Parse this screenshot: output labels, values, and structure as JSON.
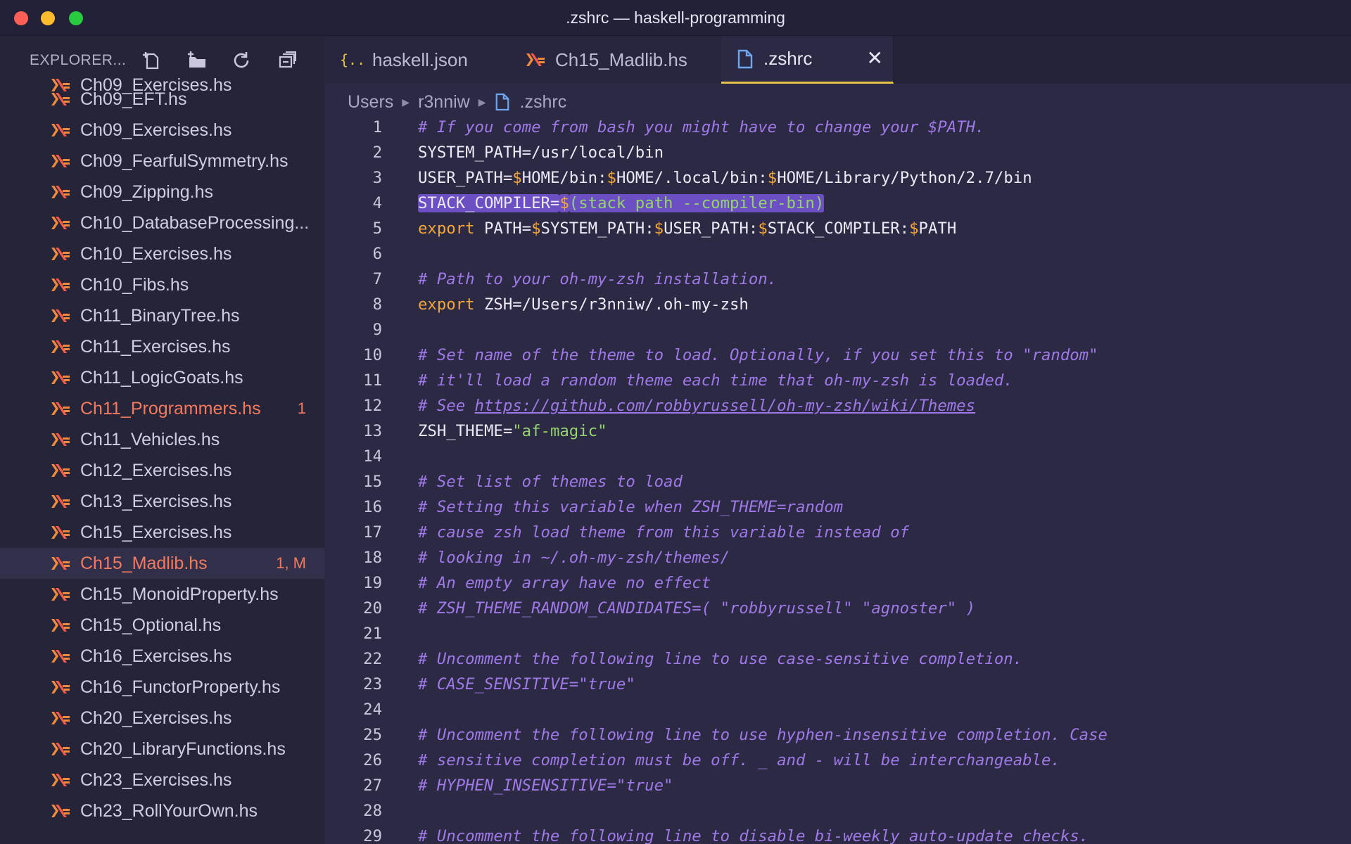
{
  "window": {
    "title": ".zshrc — haskell-programming"
  },
  "sidebar": {
    "title": "EXPLORER...",
    "partial_item": "Ch09_Exercises.hs",
    "items": [
      {
        "label": "Ch09_EFT.hs",
        "badge": "",
        "state": "normal"
      },
      {
        "label": "Ch09_Exercises.hs",
        "badge": "",
        "state": "normal"
      },
      {
        "label": "Ch09_FearfulSymmetry.hs",
        "badge": "",
        "state": "normal"
      },
      {
        "label": "Ch09_Zipping.hs",
        "badge": "",
        "state": "normal"
      },
      {
        "label": "Ch10_DatabaseProcessing...",
        "badge": "",
        "state": "normal"
      },
      {
        "label": "Ch10_Exercises.hs",
        "badge": "",
        "state": "normal"
      },
      {
        "label": "Ch10_Fibs.hs",
        "badge": "",
        "state": "normal"
      },
      {
        "label": "Ch11_BinaryTree.hs",
        "badge": "",
        "state": "normal"
      },
      {
        "label": "Ch11_Exercises.hs",
        "badge": "",
        "state": "normal"
      },
      {
        "label": "Ch11_LogicGoats.hs",
        "badge": "",
        "state": "normal"
      },
      {
        "label": "Ch11_Programmers.hs",
        "badge": "1",
        "state": "error"
      },
      {
        "label": "Ch11_Vehicles.hs",
        "badge": "",
        "state": "normal"
      },
      {
        "label": "Ch12_Exercises.hs",
        "badge": "",
        "state": "normal"
      },
      {
        "label": "Ch13_Exercises.hs",
        "badge": "",
        "state": "normal"
      },
      {
        "label": "Ch15_Exercises.hs",
        "badge": "",
        "state": "normal"
      },
      {
        "label": "Ch15_Madlib.hs",
        "badge": "1, M",
        "state": "error-selected"
      },
      {
        "label": "Ch15_MonoidProperty.hs",
        "badge": "",
        "state": "normal"
      },
      {
        "label": "Ch15_Optional.hs",
        "badge": "",
        "state": "normal"
      },
      {
        "label": "Ch16_Exercises.hs",
        "badge": "",
        "state": "normal"
      },
      {
        "label": "Ch16_FunctorProperty.hs",
        "badge": "",
        "state": "normal"
      },
      {
        "label": "Ch20_Exercises.hs",
        "badge": "",
        "state": "normal"
      },
      {
        "label": "Ch20_LibraryFunctions.hs",
        "badge": "",
        "state": "normal"
      },
      {
        "label": "Ch23_Exercises.hs",
        "badge": "",
        "state": "normal"
      },
      {
        "label": "Ch23_RollYourOwn.hs",
        "badge": "",
        "state": "normal"
      }
    ]
  },
  "tabs": [
    {
      "label": "haskell.json",
      "icon": "json-braces-icon",
      "active": false
    },
    {
      "label": "Ch15_Madlib.hs",
      "icon": "haskell-icon",
      "active": false
    },
    {
      "label": ".zshrc",
      "icon": "file-icon",
      "active": true
    }
  ],
  "breadcrumb": [
    "Users",
    "r3nniw",
    ".zshrc"
  ],
  "code": {
    "lines": [
      [
        [
          "comment",
          "# If you come from bash you might have to change your $PATH."
        ]
      ],
      [
        [
          "plain",
          "SYSTEM_PATH=/usr/local/bin"
        ]
      ],
      [
        [
          "plain",
          "USER_PATH="
        ],
        [
          "dollar",
          "$"
        ],
        [
          "plain",
          "HOME/bin:"
        ],
        [
          "dollar",
          "$"
        ],
        [
          "plain",
          "HOME/.local/bin:"
        ],
        [
          "dollar",
          "$"
        ],
        [
          "plain",
          "HOME/Library/Python/2.7/bin"
        ]
      ],
      [
        [
          "hl-plain",
          "STACK_COMPILER="
        ],
        [
          "hl-dollar",
          "$"
        ],
        [
          "hl-string",
          "(stack path --compiler-bin)"
        ]
      ],
      [
        [
          "keyword",
          "export"
        ],
        [
          "plain",
          " PATH="
        ],
        [
          "dollar",
          "$"
        ],
        [
          "plain",
          "SYSTEM_PATH:"
        ],
        [
          "dollar",
          "$"
        ],
        [
          "plain",
          "USER_PATH:"
        ],
        [
          "dollar",
          "$"
        ],
        [
          "plain",
          "STACK_COMPILER:"
        ],
        [
          "dollar",
          "$"
        ],
        [
          "plain",
          "PATH"
        ]
      ],
      [],
      [
        [
          "comment",
          "# Path to your oh-my-zsh installation."
        ]
      ],
      [
        [
          "keyword",
          "export"
        ],
        [
          "plain",
          " ZSH=/Users/r3nniw/.oh-my-zsh"
        ]
      ],
      [],
      [
        [
          "comment",
          "# Set name of the theme to load. Optionally, if you set this to \"random\""
        ]
      ],
      [
        [
          "comment",
          "# it'll load a random theme each time that oh-my-zsh is loaded."
        ]
      ],
      [
        [
          "comment",
          "# See "
        ],
        [
          "link",
          "https://github.com/robbyrussell/oh-my-zsh/wiki/Themes"
        ]
      ],
      [
        [
          "plain",
          "ZSH_THEME="
        ],
        [
          "string",
          "\"af-magic\""
        ]
      ],
      [],
      [
        [
          "comment",
          "# Set list of themes to load"
        ]
      ],
      [
        [
          "comment",
          "# Setting this variable when ZSH_THEME=random"
        ]
      ],
      [
        [
          "comment",
          "# cause zsh load theme from this variable instead of"
        ]
      ],
      [
        [
          "comment",
          "# looking in ~/.oh-my-zsh/themes/"
        ]
      ],
      [
        [
          "comment",
          "# An empty array have no effect"
        ]
      ],
      [
        [
          "comment",
          "# ZSH_THEME_RANDOM_CANDIDATES=( \"robbyrussell\" \"agnoster\" )"
        ]
      ],
      [],
      [
        [
          "comment",
          "# Uncomment the following line to use case-sensitive completion."
        ]
      ],
      [
        [
          "comment",
          "# CASE_SENSITIVE=\"true\""
        ]
      ],
      [],
      [
        [
          "comment",
          "# Uncomment the following line to use hyphen-insensitive completion. Case"
        ]
      ],
      [
        [
          "comment",
          "# sensitive completion must be off. _ and - will be interchangeable."
        ]
      ],
      [
        [
          "comment",
          "# HYPHEN_INSENSITIVE=\"true\""
        ]
      ],
      [],
      [
        [
          "comment",
          "# Uncomment the following line to disable bi-weekly auto-update checks."
        ]
      ]
    ]
  },
  "colors": {
    "accent_tab": "#e5c24a",
    "error": "#f27a5e",
    "comment": "#9f79e8",
    "keyword": "#f3a738",
    "string": "#95d36f",
    "selection": "#6b4fc3"
  }
}
